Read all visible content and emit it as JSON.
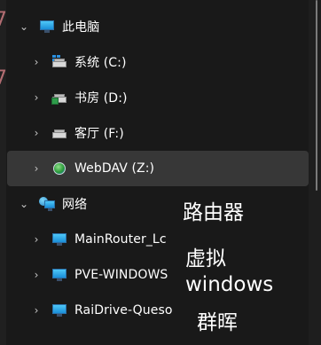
{
  "tree": {
    "this_pc": {
      "label": "此电脑",
      "expanded": true,
      "icon": "monitor-icon"
    },
    "drives": [
      {
        "label": "系统 (C:)",
        "icon": "system-drive-icon"
      },
      {
        "label": "书房 (D:)",
        "icon": "book-drive-icon"
      },
      {
        "label": "客厅 (F:)",
        "icon": "drive-icon"
      },
      {
        "label": "WebDAV (Z:)",
        "icon": "webdav-globe-icon",
        "selected": true
      }
    ],
    "network": {
      "label": "网络",
      "expanded": true,
      "icon": "network-icon"
    },
    "network_items": [
      {
        "label": "MainRouter_Lc",
        "icon": "monitor-icon"
      },
      {
        "label": "PVE-WINDOWS",
        "icon": "monitor-icon"
      },
      {
        "label": "RaiDrive-Queso",
        "icon": "monitor-icon"
      }
    ]
  },
  "annotations": {
    "router": "路由器",
    "virtual": "虚拟",
    "windows": "windows",
    "synology": "群晖"
  },
  "colors": {
    "background": "#191919",
    "selected_row": "#373737",
    "accent_icon": "#2a8fde"
  }
}
